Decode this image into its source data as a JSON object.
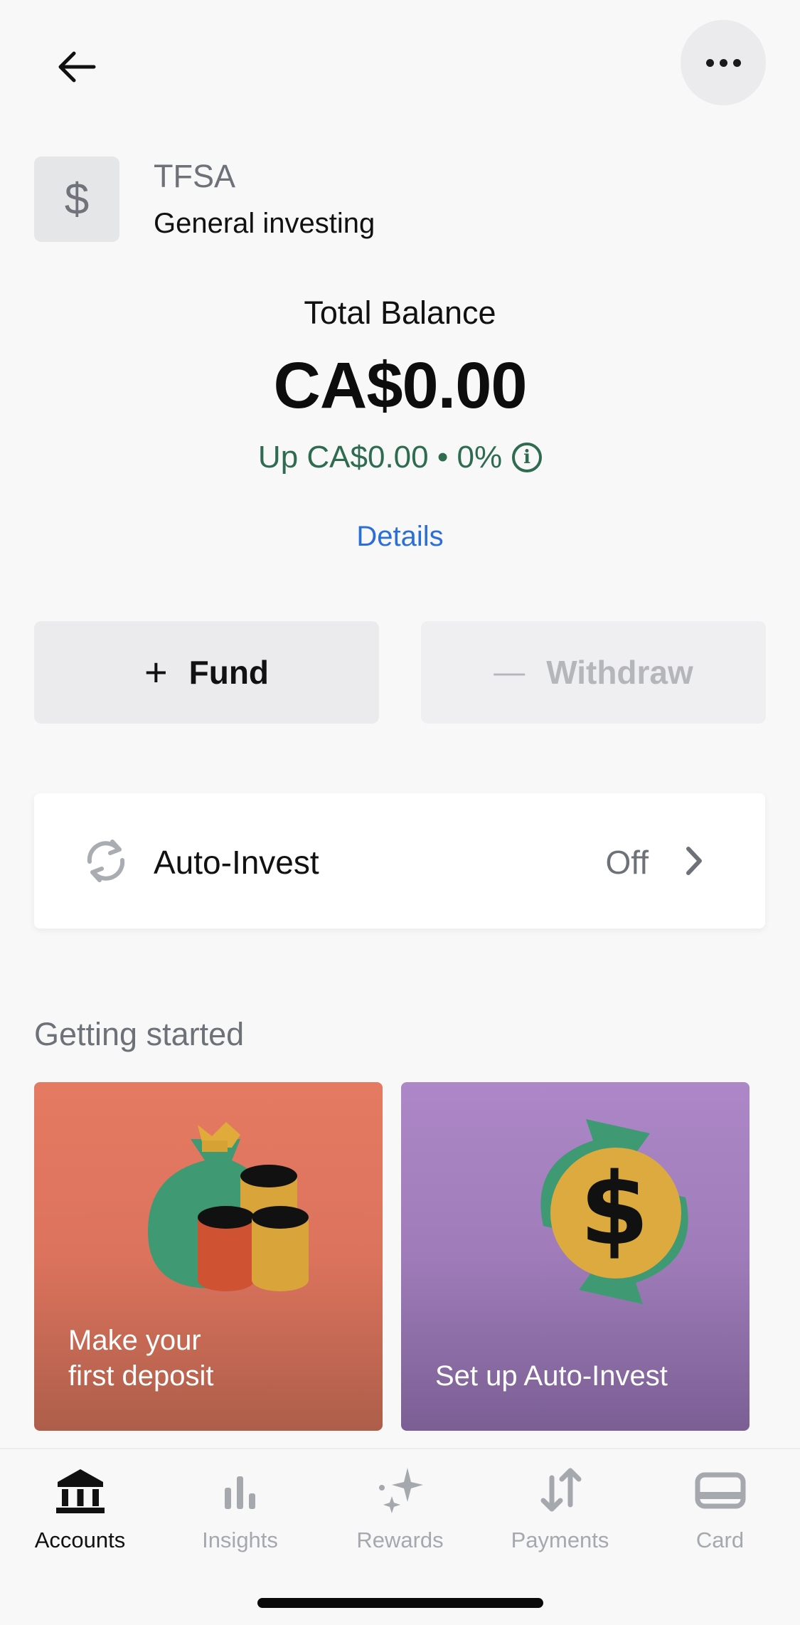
{
  "header": {
    "back_icon": "arrow-left-icon",
    "more_icon": "ellipsis-icon"
  },
  "account": {
    "icon_glyph": "$",
    "type": "TFSA",
    "name": "General investing"
  },
  "balance": {
    "label": "Total Balance",
    "amount": "CA$0.00",
    "change_text": "Up CA$0.00 • 0%",
    "info_glyph": "i",
    "details_link": "Details",
    "change_color": "#2e6b4f"
  },
  "actions": {
    "fund_glyph": "+",
    "fund_label": "Fund",
    "withdraw_glyph": "—",
    "withdraw_label": "Withdraw"
  },
  "auto_invest": {
    "icon": "sync-icon",
    "label": "Auto-Invest",
    "status": "Off"
  },
  "getting_started": {
    "title": "Getting started",
    "cards": [
      {
        "line1": "Make your",
        "line2": "first deposit",
        "color": "#e57a62"
      },
      {
        "line1": "Set up Auto-Invest",
        "color": "#ad87c7",
        "art_glyph": "$"
      }
    ]
  },
  "tabs": [
    {
      "label": "Accounts",
      "icon": "bank-icon",
      "active": true
    },
    {
      "label": "Insights",
      "icon": "bar-chart-icon",
      "active": false
    },
    {
      "label": "Rewards",
      "icon": "sparkles-icon",
      "active": false
    },
    {
      "label": "Payments",
      "icon": "transfer-arrows-icon",
      "active": false
    },
    {
      "label": "Card",
      "icon": "card-icon",
      "active": false
    }
  ],
  "colors": {
    "link": "#2b6fd6",
    "background": "#f8f8f8"
  }
}
